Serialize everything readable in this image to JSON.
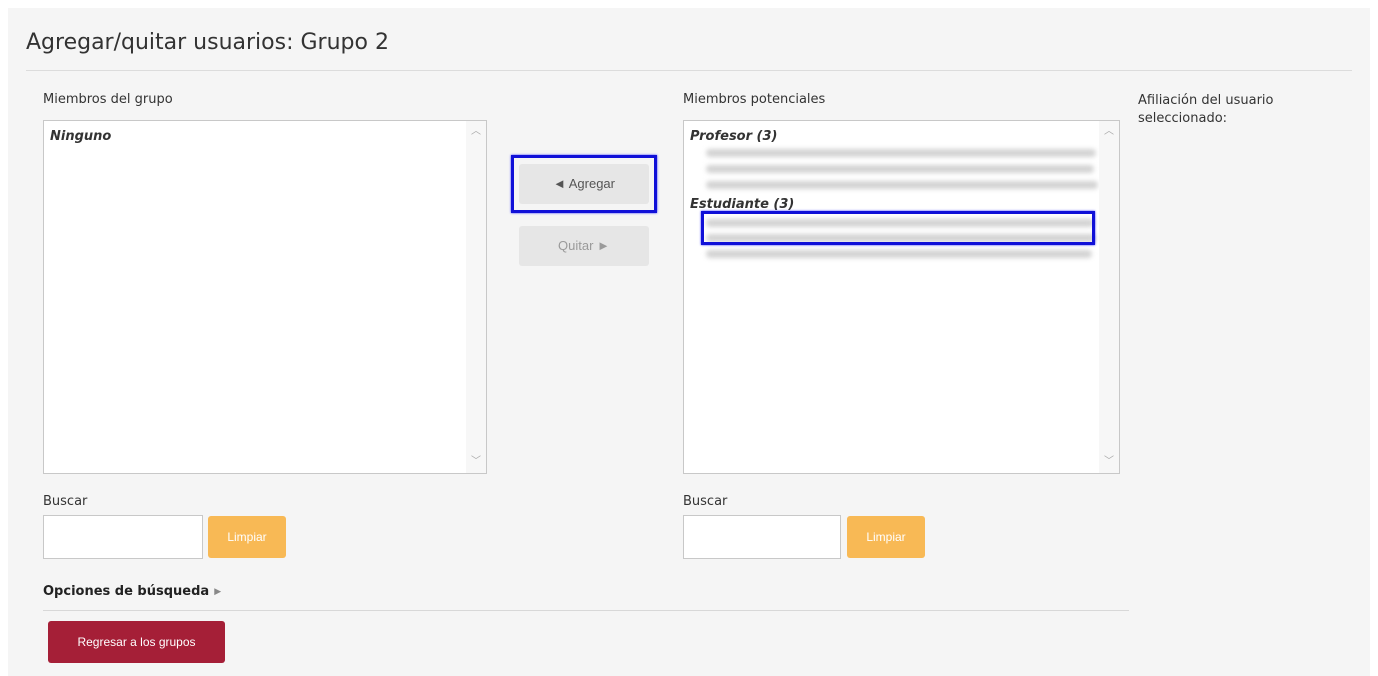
{
  "page": {
    "title": "Agregar/quitar usuarios: Grupo 2"
  },
  "members": {
    "label": "Miembros del grupo",
    "empty_group": "Ninguno"
  },
  "actions": {
    "add_label": "◄ Agregar",
    "remove_label": "Quitar ►"
  },
  "potential": {
    "label": "Miembros potenciales",
    "groups": [
      {
        "label": "Profesor (3)"
      },
      {
        "label": "Estudiante (3)"
      }
    ]
  },
  "affiliation": {
    "label": "Afiliación del usuario seleccionado:"
  },
  "search_left": {
    "label": "Buscar",
    "clear_label": "Limpiar",
    "value": ""
  },
  "search_right": {
    "label": "Buscar",
    "clear_label": "Limpiar",
    "value": ""
  },
  "search_options": {
    "label": "Opciones de búsqueda"
  },
  "footer": {
    "back_label": "Regresar a los grupos"
  },
  "colors": {
    "accent_red": "#a51f37",
    "clear_orange": "#f8b955",
    "highlight_blue": "#1010d8"
  },
  "icons": {
    "scroll_up": "chevron-up-icon",
    "scroll_down": "chevron-down-icon",
    "expand": "caret-right-icon"
  }
}
